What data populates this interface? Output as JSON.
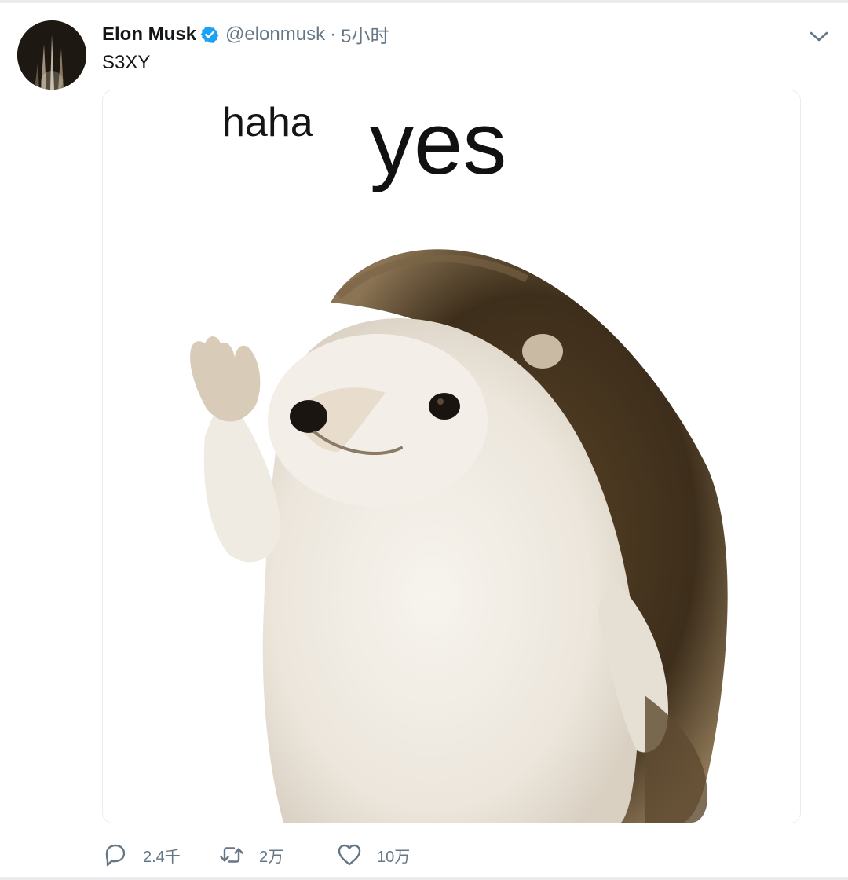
{
  "tweet": {
    "author_name": "Elon Musk",
    "handle": "@elonmusk",
    "separator": "·",
    "time": "5小时",
    "text": "S3XY",
    "verified": true
  },
  "media": {
    "caption_small": "haha",
    "caption_large": "yes"
  },
  "actions": {
    "reply_count": "2.4千",
    "retweet_count": "2万",
    "like_count": "10万"
  },
  "icons": {
    "verified": "verified-badge-icon",
    "more": "chevron-down-icon",
    "reply": "reply-icon",
    "retweet": "retweet-icon",
    "like": "heart-icon"
  },
  "colors": {
    "verified_blue": "#1da1f2",
    "meta_gray": "#657786",
    "text_dark": "#14171a"
  }
}
